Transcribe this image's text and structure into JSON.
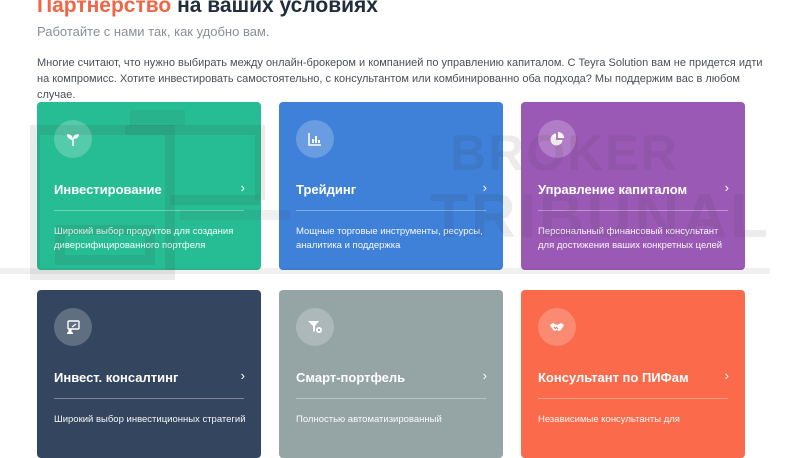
{
  "header": {
    "title_accent": "Партнёрство",
    "title_rest": " на ваших условиях",
    "subtitle": "Работайте с нами так, как удобно вам.",
    "intro": "Многие считают, что нужно выбирать между онлайн-брокером и компанией по управлению капиталом. С Teyra Solution вам не придется идти на компромисс. Хотите инвестировать самостоятельно, с консультантом или комбинированно оба подхода? Мы поддержим вас в любом случае."
  },
  "watermark": {
    "line1": "BROKER",
    "line2": "TRIBUNAL"
  },
  "cards": [
    {
      "name": "Инвестирование",
      "desc": "Широкий выбор продуктов для создания диверсифицированного портфеля",
      "color": "#26bd94",
      "icon": "sprout-icon",
      "chevron": "›"
    },
    {
      "name": "Трейдинг",
      "desc": "Мощные торговые инструменты, ресурсы, аналитика и поддержка",
      "color": "#3f80d8",
      "icon": "bar-chart-icon",
      "chevron": "›"
    },
    {
      "name": "Управление капиталом",
      "desc": "Персональный финансовый консультант для достижения ваших конкретных целей",
      "color": "#9b59b6",
      "icon": "pie-chart-icon",
      "chevron": "›"
    },
    {
      "name": "Инвест. консалтинг",
      "desc": "Широкий выбор инвестиционных стратегий",
      "color": "#34465f",
      "icon": "presentation-icon",
      "chevron": "›"
    },
    {
      "name": "Смарт-портфель",
      "desc": "Полностью автоматизированный",
      "color": "#95a5a6",
      "icon": "funnel-gear-icon",
      "chevron": "›"
    },
    {
      "name": "Консультант по ПИФам",
      "desc": "Независимые консультанты для",
      "color": "#fa6a4b",
      "icon": "handshake-icon",
      "chevron": "›"
    }
  ]
}
